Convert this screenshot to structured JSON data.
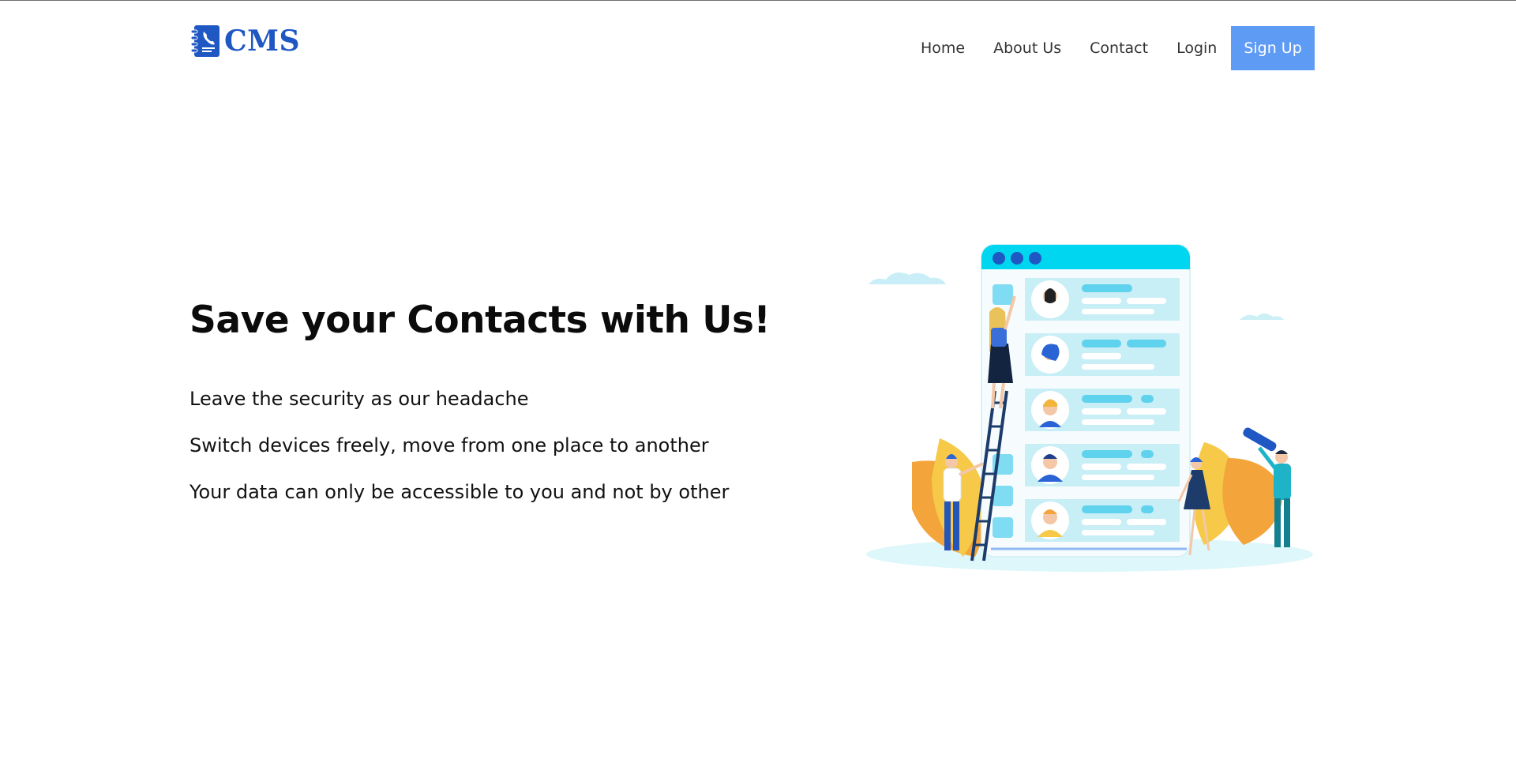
{
  "brand": {
    "name": "CMS",
    "color": "#1f57c3",
    "icon": "contact-book-icon"
  },
  "nav": {
    "items": [
      {
        "label": "Home"
      },
      {
        "label": "About Us"
      },
      {
        "label": "Contact"
      },
      {
        "label": "Login"
      }
    ],
    "signup_label": "Sign Up",
    "signup_color": "#5e9bf5"
  },
  "hero": {
    "title": "Save your Contacts with Us!",
    "lines": [
      "Leave the security as our headache",
      "Switch devices freely, move from one place to another",
      "Your data can only be accessible to you and not by other"
    ]
  },
  "illustration": {
    "subject": "contact-list-illustration",
    "accent_colors": [
      "#00d6f0",
      "#f3a43b",
      "#cdeff6",
      "#2a63d6"
    ]
  }
}
